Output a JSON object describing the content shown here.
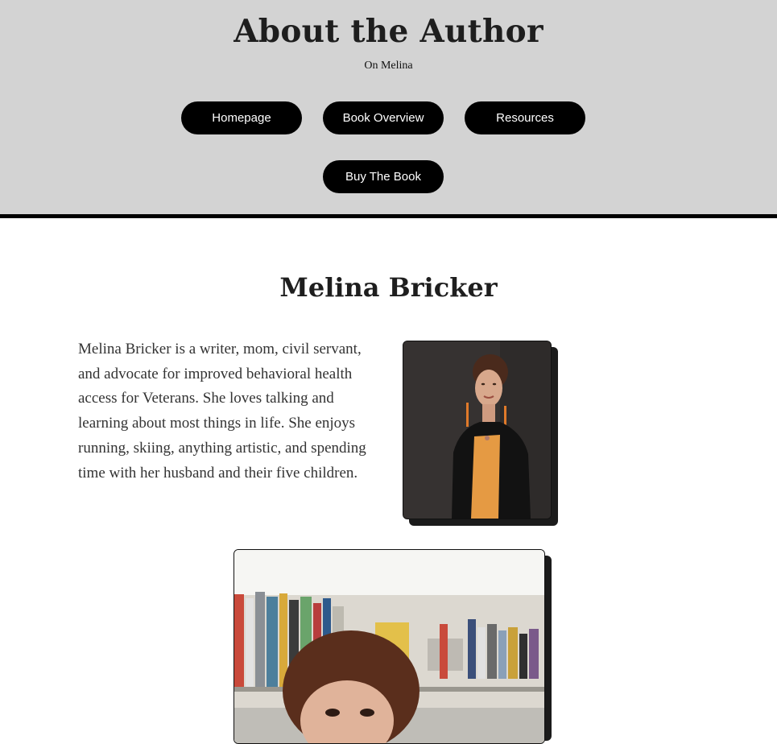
{
  "header": {
    "title": "About the Author",
    "subtitle": "On Melina",
    "nav": [
      {
        "label": "Homepage"
      },
      {
        "label": "Book Overview"
      },
      {
        "label": "Resources"
      },
      {
        "label": "Buy The Book"
      }
    ]
  },
  "main": {
    "author_name": "Melina Bricker",
    "bio": "Melina Bricker is a writer, mom, civil servant, and advocate for improved behavioral health access for Veterans. She loves talking and learning about most things in life. She enjoys running, skiing, anything artistic, and spending time with her husband and their five children.",
    "images": [
      {
        "name": "author-portrait",
        "alt": ""
      },
      {
        "name": "author-library-photo",
        "alt": ""
      }
    ]
  },
  "colors": {
    "header_bg": "#d3d3d3",
    "button_bg": "#000000",
    "button_text": "#ffffff",
    "divider": "#000000"
  }
}
